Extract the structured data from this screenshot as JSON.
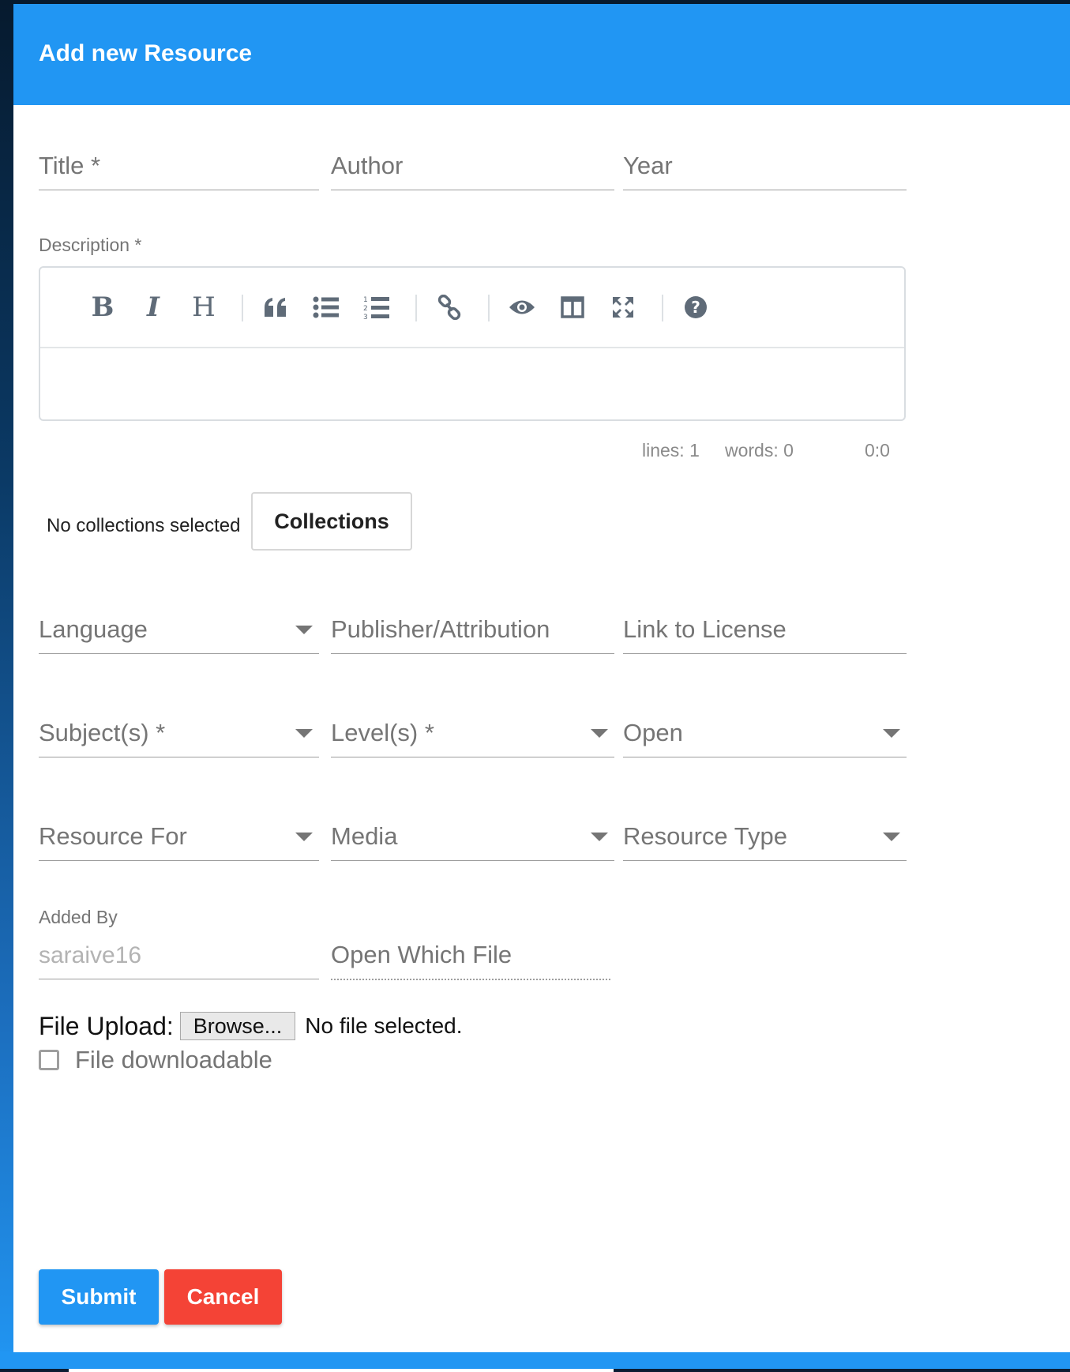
{
  "dialog": {
    "title": "Add new Resource"
  },
  "fields": {
    "title": "Title *",
    "author": "Author",
    "year": "Year",
    "description_label": "Description *",
    "language": "Language",
    "publisher": "Publisher/Attribution",
    "license": "Link to License",
    "subjects": "Subject(s) *",
    "levels": "Level(s) *",
    "open": "Open",
    "resource_for": "Resource For",
    "media": "Media",
    "resource_type": "Resource Type",
    "added_by_label": "Added By",
    "added_by_value": "saraive16",
    "open_which_file": "Open Which File"
  },
  "editor": {
    "toolbar": [
      "bold-icon",
      "italic-icon",
      "heading-icon",
      "quote-icon",
      "unordered-list-icon",
      "ordered-list-icon",
      "link-icon",
      "preview-icon",
      "side-by-side-icon",
      "fullscreen-icon",
      "help-icon"
    ],
    "bold_glyph": "B",
    "italic_glyph": "I",
    "heading_glyph": "H",
    "status": {
      "lines": "lines: 1",
      "words": "words: 0",
      "cursor": "0:0"
    }
  },
  "collections": {
    "text": "No collections selected",
    "button": "Collections"
  },
  "upload": {
    "label": "File Upload:",
    "browse": "Browse...",
    "status": "No file selected."
  },
  "downloadable": {
    "label": "File downloadable",
    "checked": false
  },
  "actions": {
    "submit": "Submit",
    "cancel": "Cancel"
  },
  "colors": {
    "primary": "#2196f3",
    "danger": "#f44336"
  }
}
